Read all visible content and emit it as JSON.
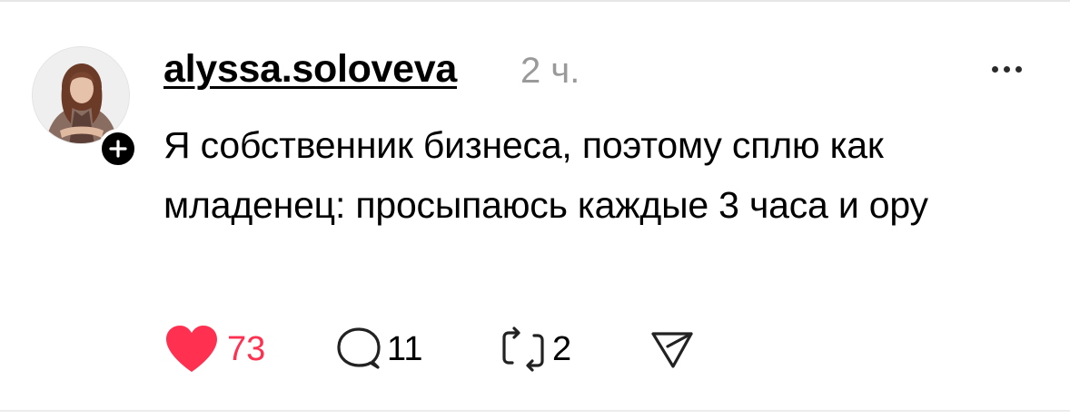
{
  "post": {
    "username": "alyssa.soloveva",
    "timestamp": "2 ч.",
    "text": "Я собственник бизнеса, поэтому сплю как младенец: просыпаюсь каждые 3 часа и ору"
  },
  "actions": {
    "likes": "73",
    "comments": "11",
    "reposts": "2"
  },
  "icons": {
    "like": "heart-icon",
    "comment": "comment-bubble-icon",
    "repost": "repost-icon",
    "share": "send-icon",
    "follow": "plus-icon",
    "more": "ellipsis-icon"
  },
  "colors": {
    "like_active": "#ff3050",
    "timestamp": "#9a9a9a",
    "text": "#000000"
  }
}
